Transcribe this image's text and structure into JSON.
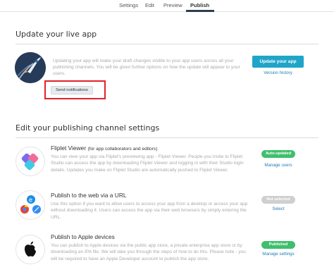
{
  "tabs": [
    {
      "label": "Settings"
    },
    {
      "label": "Edit"
    },
    {
      "label": "Preview"
    },
    {
      "label": "Publish",
      "active": true
    }
  ],
  "update_section": {
    "title": "Update your live app",
    "description": "Updating your app will make your draft changes visible to your app users across all your publishing channels. You will be given further options on how the update will appear to your users.",
    "send_notifications_label": "Send notifications",
    "update_button_label": "Update your app",
    "version_history_label": "Version history"
  },
  "channels_section": {
    "title": "Edit your publishing channel settings",
    "channels": [
      {
        "title": "Fliplet Viewer",
        "subtitle": "(for app collaborators and editors)",
        "description": "You can view your app via Fliplet's previewing app - Fliplet Viewer. People you invite to Fliplet Studio can access the app by downloading Fliplet Viewer and logging in with their Studio login details. Updates you make on Fliplet Studio are automatically pushed to Fliplet Viewer.",
        "status": "Auto-updated",
        "status_color": "#3fbf6d",
        "action": "Manage users",
        "icon": "fliplet-viewer-icon"
      },
      {
        "title": "Publish to the web via a URL",
        "subtitle": "",
        "description": "Use this option if you want to allow users to access your app from a desktop or access your app without downloading it. Users can access the app via their web browsers by simply entering the URL.",
        "status": "Not selected",
        "status_color": "#cfcfcf",
        "action": "Select",
        "icon": "web-browsers-icon"
      },
      {
        "title": "Publish to Apple devices",
        "subtitle": "",
        "description": "You can publish to Apple devices via the public app store, a private enterprise app store or by downloading an IPA file. We will take you through the steps of how to do this. Please note - you will be required to have an Apple Developer account to publish the app store.",
        "status": "Published",
        "status_color": "#3fbf6d",
        "action": "Manage settings",
        "icon": "apple-icon"
      }
    ]
  }
}
